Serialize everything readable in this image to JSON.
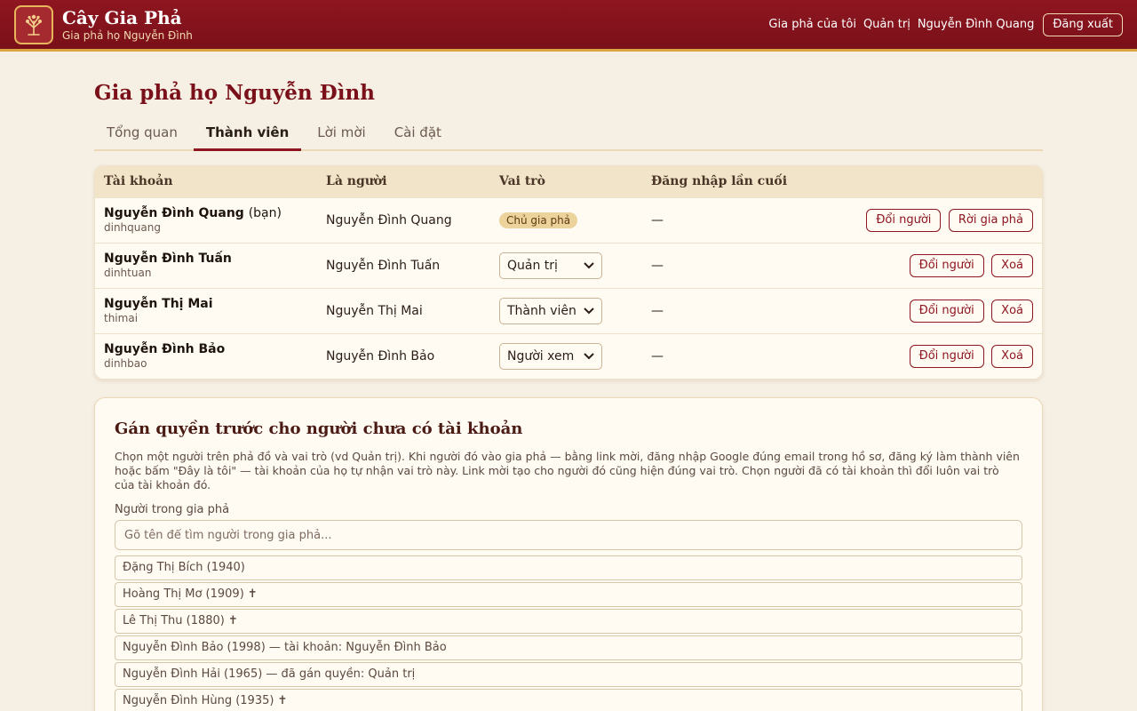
{
  "header": {
    "brand_title": "Cây Gia Phả",
    "brand_subtitle": "Gia phả họ Nguyễn Đình",
    "nav": [
      "Gia phả của tôi",
      "Quản trị",
      "Nguyễn Đình Quang"
    ],
    "logout": "Đăng xuất"
  },
  "page": {
    "title": "Gia phả họ Nguyễn Đình",
    "tabs": [
      "Tổng quan",
      "Thành viên",
      "Lời mời",
      "Cài đặt"
    ],
    "active_tab": "Thành viên"
  },
  "members": {
    "headers": [
      "Tài khoản",
      "Là người",
      "Vai trò",
      "Đăng nhập lần cuối"
    ],
    "rows": [
      {
        "name": "Nguyễn Đình Quang",
        "you": "(bạn)",
        "username": "dinhquang",
        "person": "Nguyễn Đình Quang",
        "role": "Chủ gia phả",
        "last_login": "—",
        "action1": "Đổi người",
        "action2": "Rời gia phả"
      },
      {
        "name": "Nguyễn Đình Tuấn",
        "username": "dinhtuan",
        "person": "Nguyễn Đình Tuấn",
        "role": "Quản trị",
        "last_login": "—",
        "action1": "Đổi người",
        "action2": "Xoá"
      },
      {
        "name": "Nguyễn Thị Mai",
        "username": "thimai",
        "person": "Nguyễn Thị Mai",
        "role": "Thành viên",
        "last_login": "—",
        "action1": "Đổi người",
        "action2": "Xoá"
      },
      {
        "name": "Nguyễn Đình Bảo",
        "username": "dinhbao",
        "person": "Nguyễn Đình Bảo",
        "role": "Người xem",
        "last_login": "—",
        "action1": "Đổi người",
        "action2": "Xoá"
      }
    ]
  },
  "assign": {
    "title": "Gán quyền trước cho người chưa có tài khoản",
    "description": "Chọn một người trên phả đồ và vai trò (vd Quản trị). Khi người đó vào gia phả — bằng link mời, đăng nhập Google đúng email trong hồ sơ, đăng ký làm thành viên hoặc bấm \"Đây là tôi\" — tài khoản của họ tự nhận vai trò này. Link mời tạo cho người đó cũng hiện đúng vai trò. Chọn người đã có tài khoản thì đổi luôn vai trò của tài khoản đó.",
    "field_label": "Người trong gia phả",
    "search_placeholder": "Gõ tên để tìm người trong gia phả...",
    "people": [
      "Đặng Thị Bích (1940)",
      "Hoàng Thị Mơ (1909) ✝",
      "Lê Thị Thu (1880) ✝",
      "Nguyễn Đình Bảo (1998) — tài khoản: Nguyễn Đình Bảo",
      "Nguyễn Đình Hải (1965) — đã gán quyền: Quản trị",
      "Nguyễn Đình Hùng (1935) ✝"
    ]
  },
  "colors": {
    "header_bg": "#8e1620",
    "accent_gold": "#d9a53f",
    "page_bg": "#f6efe3",
    "role_badge": "#ecd29b"
  },
  "icons": {
    "logo": "family-tree-icon",
    "select_caret": "chevron-down-icon"
  }
}
